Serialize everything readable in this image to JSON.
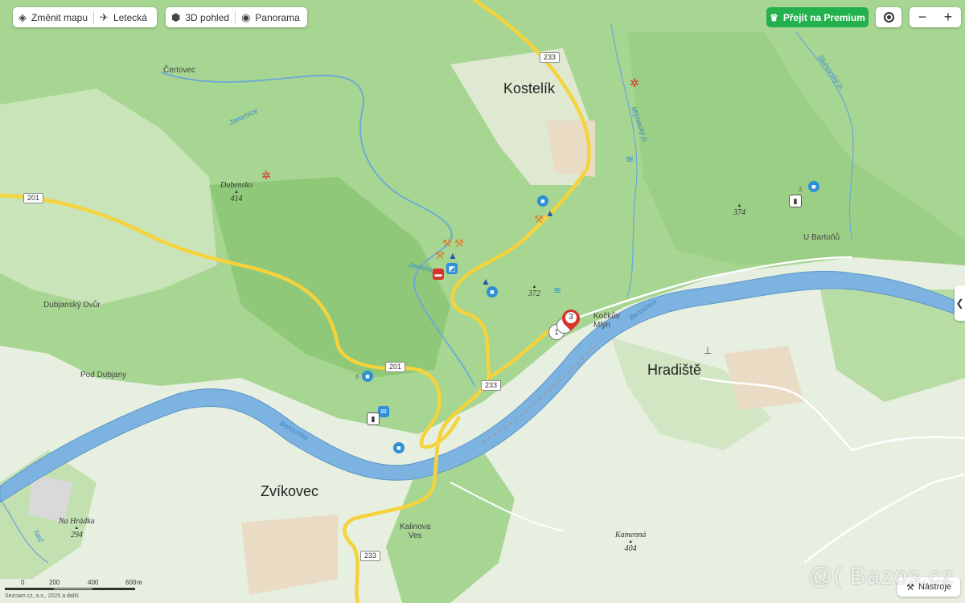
{
  "toolbar_left": {
    "change_map": "Změnit mapu",
    "aerial": "Letecká"
  },
  "toolbar_view": {
    "view3d": "3D pohled",
    "panorama": "Panorama"
  },
  "premium": {
    "label": "Přejít na Premium",
    "color": "#22b14c"
  },
  "zoom": {
    "minus": "−",
    "plus": "+"
  },
  "tools": {
    "label": "Nástroje"
  },
  "places": {
    "kostelik": "Kostelík",
    "hradiste": "Hradiště",
    "zvikovec": "Zvíkovec",
    "certovec": "Čertovec",
    "dubjansky_dvur": "Dubjanský Dvůr",
    "pod_dubjany": "Pod Dubjany",
    "kockuv_mlyn_1": "Kočkův",
    "kockuv_mlyn_2": "Mlýn",
    "kalinova_1": "Kalinova",
    "kalinova_2": "Ves",
    "u_bartonu": "U Bartoňů"
  },
  "peaks": {
    "dubensko_name": "Dubensko",
    "dubensko_elev": "414",
    "na_hradku_name": "Na Hrádku",
    "na_hradku_elev": "294",
    "kamenna_name": "Kamenná",
    "kamenna_elev": "404",
    "p372": "372",
    "p374": "374"
  },
  "waters": {
    "berounka_1": "Berounka",
    "berounka_2": "Berounka",
    "javornice_1": "Javornice",
    "javornice_2": "Javornice",
    "mlynecky": "Mlýnecký p.",
    "sluhovsky": "Sluhovský p.",
    "nec": "Neč"
  },
  "roads": {
    "r201_a": "201",
    "r201_b": "201",
    "r233_a": "233",
    "r233_b": "233",
    "r233_c": "233"
  },
  "marker": {
    "count": "3",
    "sub": "1"
  },
  "scale": {
    "t0": "0",
    "t200": "200",
    "t400": "400",
    "t600": "600",
    "unit": "m",
    "copyright": "Seznam.cz, a.s., 2025 a další"
  },
  "watermark": "@( Bazos.cz",
  "colors": {
    "forest": "#9fd08a",
    "meadow": "#e7efe0",
    "river": "#6fa8dc",
    "road": "#f5d33c",
    "poi_blue": "#2f8fd8",
    "poi_red": "#d9322b"
  },
  "icons": {
    "layers": "layers-icon",
    "plane": "plane-icon",
    "cube": "cube-icon",
    "eye": "eye-icon",
    "crown": "crown-icon",
    "record": "location-target-icon",
    "tools": "tools-icon",
    "chevron": "chevron-left-icon"
  }
}
